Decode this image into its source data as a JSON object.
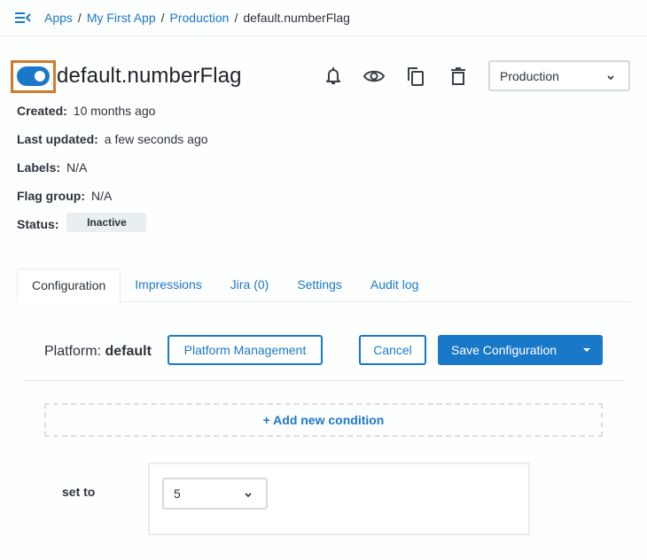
{
  "breadcrumb": {
    "items": [
      {
        "label": "Apps",
        "link": true
      },
      {
        "label": "My First App",
        "link": true
      },
      {
        "label": "Production",
        "link": true
      },
      {
        "label": "default.numberFlag",
        "link": false
      }
    ],
    "separator": "/"
  },
  "flag": {
    "name": "default.numberFlag",
    "enabled": true
  },
  "header_icons": [
    "bell-icon",
    "eye-icon",
    "copy-icon",
    "trash-icon"
  ],
  "environment_select": {
    "value": "Production"
  },
  "meta": {
    "created_label": "Created:",
    "created_value": "10 months ago",
    "updated_label": "Last updated:",
    "updated_value": "a few seconds ago",
    "labels_label": "Labels:",
    "labels_value": "N/A",
    "group_label": "Flag group:",
    "group_value": "N/A",
    "status_label": "Status:",
    "status_value": "Inactive"
  },
  "tabs": [
    {
      "label": "Configuration",
      "active": true
    },
    {
      "label": "Impressions",
      "active": false
    },
    {
      "label": "Jira (0)",
      "active": false
    },
    {
      "label": "Settings",
      "active": false
    },
    {
      "label": "Audit log",
      "active": false
    }
  ],
  "platform": {
    "label": "Platform:",
    "value": "default",
    "management_button": "Platform Management",
    "cancel_button": "Cancel",
    "save_button": "Save Configuration"
  },
  "conditions": {
    "add_label": "+ Add new condition"
  },
  "default_value": {
    "label": "set to",
    "value": "5"
  },
  "colors": {
    "accent": "#1a78c9",
    "highlight": "#d27a2c",
    "badge_bg": "#e9eef0"
  }
}
